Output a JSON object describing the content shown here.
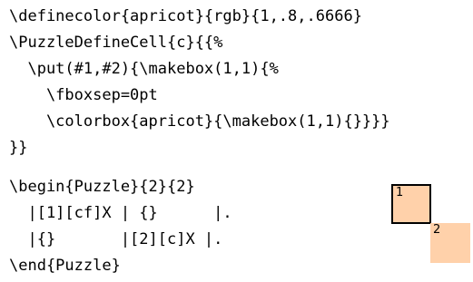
{
  "code_lines_top": [
    "\\definecolor{apricot}{rgb}{1,.8,.6666}",
    "\\PuzzleDefineCell{c}{{%",
    "  \\put(#1,#2){\\makebox(1,1){%",
    "    \\fboxsep=0pt",
    "    \\colorbox{apricot}{\\makebox(1,1){}}}}",
    "}}"
  ],
  "code_lines_bottom": [
    "\\begin{Puzzle}{2}{2}",
    "  |[1][cf]X | {}      |.",
    "  |{}       |[2][c]X |.",
    "\\end{Puzzle}"
  ],
  "puzzle_cells": [
    {
      "number": "1",
      "fill": "#ffd1aa",
      "framed": true
    },
    {
      "number": "2",
      "fill": "#ffd1aa",
      "framed": false
    }
  ],
  "colors": {
    "apricot": "#ffd1aa",
    "frame": "#000000",
    "text": "#000000"
  }
}
